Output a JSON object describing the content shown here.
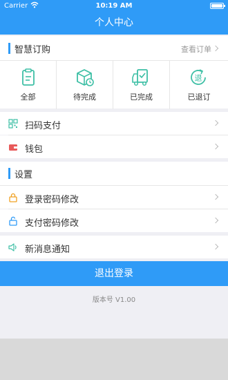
{
  "status": {
    "carrier": "Carrier",
    "time": "10:19 AM"
  },
  "nav": {
    "title": "个人中心"
  },
  "orders": {
    "title": "智慧订购",
    "view_all": "查看订单",
    "items": [
      {
        "label": "全部",
        "icon": "clipboard-icon"
      },
      {
        "label": "待完成",
        "icon": "package-clock-icon"
      },
      {
        "label": "已完成",
        "icon": "truck-check-icon"
      },
      {
        "label": "已退订",
        "icon": "refund-icon"
      }
    ]
  },
  "payments": {
    "scan_pay": "扫码支付",
    "wallet": "钱包"
  },
  "settings": {
    "title": "设置",
    "login_pwd": "登录密码修改",
    "pay_pwd": "支付密码修改"
  },
  "notify": {
    "label": "新消息通知"
  },
  "logout_label": "退出登录",
  "version": "版本号 V1.00",
  "colors": {
    "accent": "#2f9bf7",
    "icon_teal": "#3dbfa5",
    "icon_orange": "#f0a020",
    "icon_red": "#e85a5a"
  }
}
